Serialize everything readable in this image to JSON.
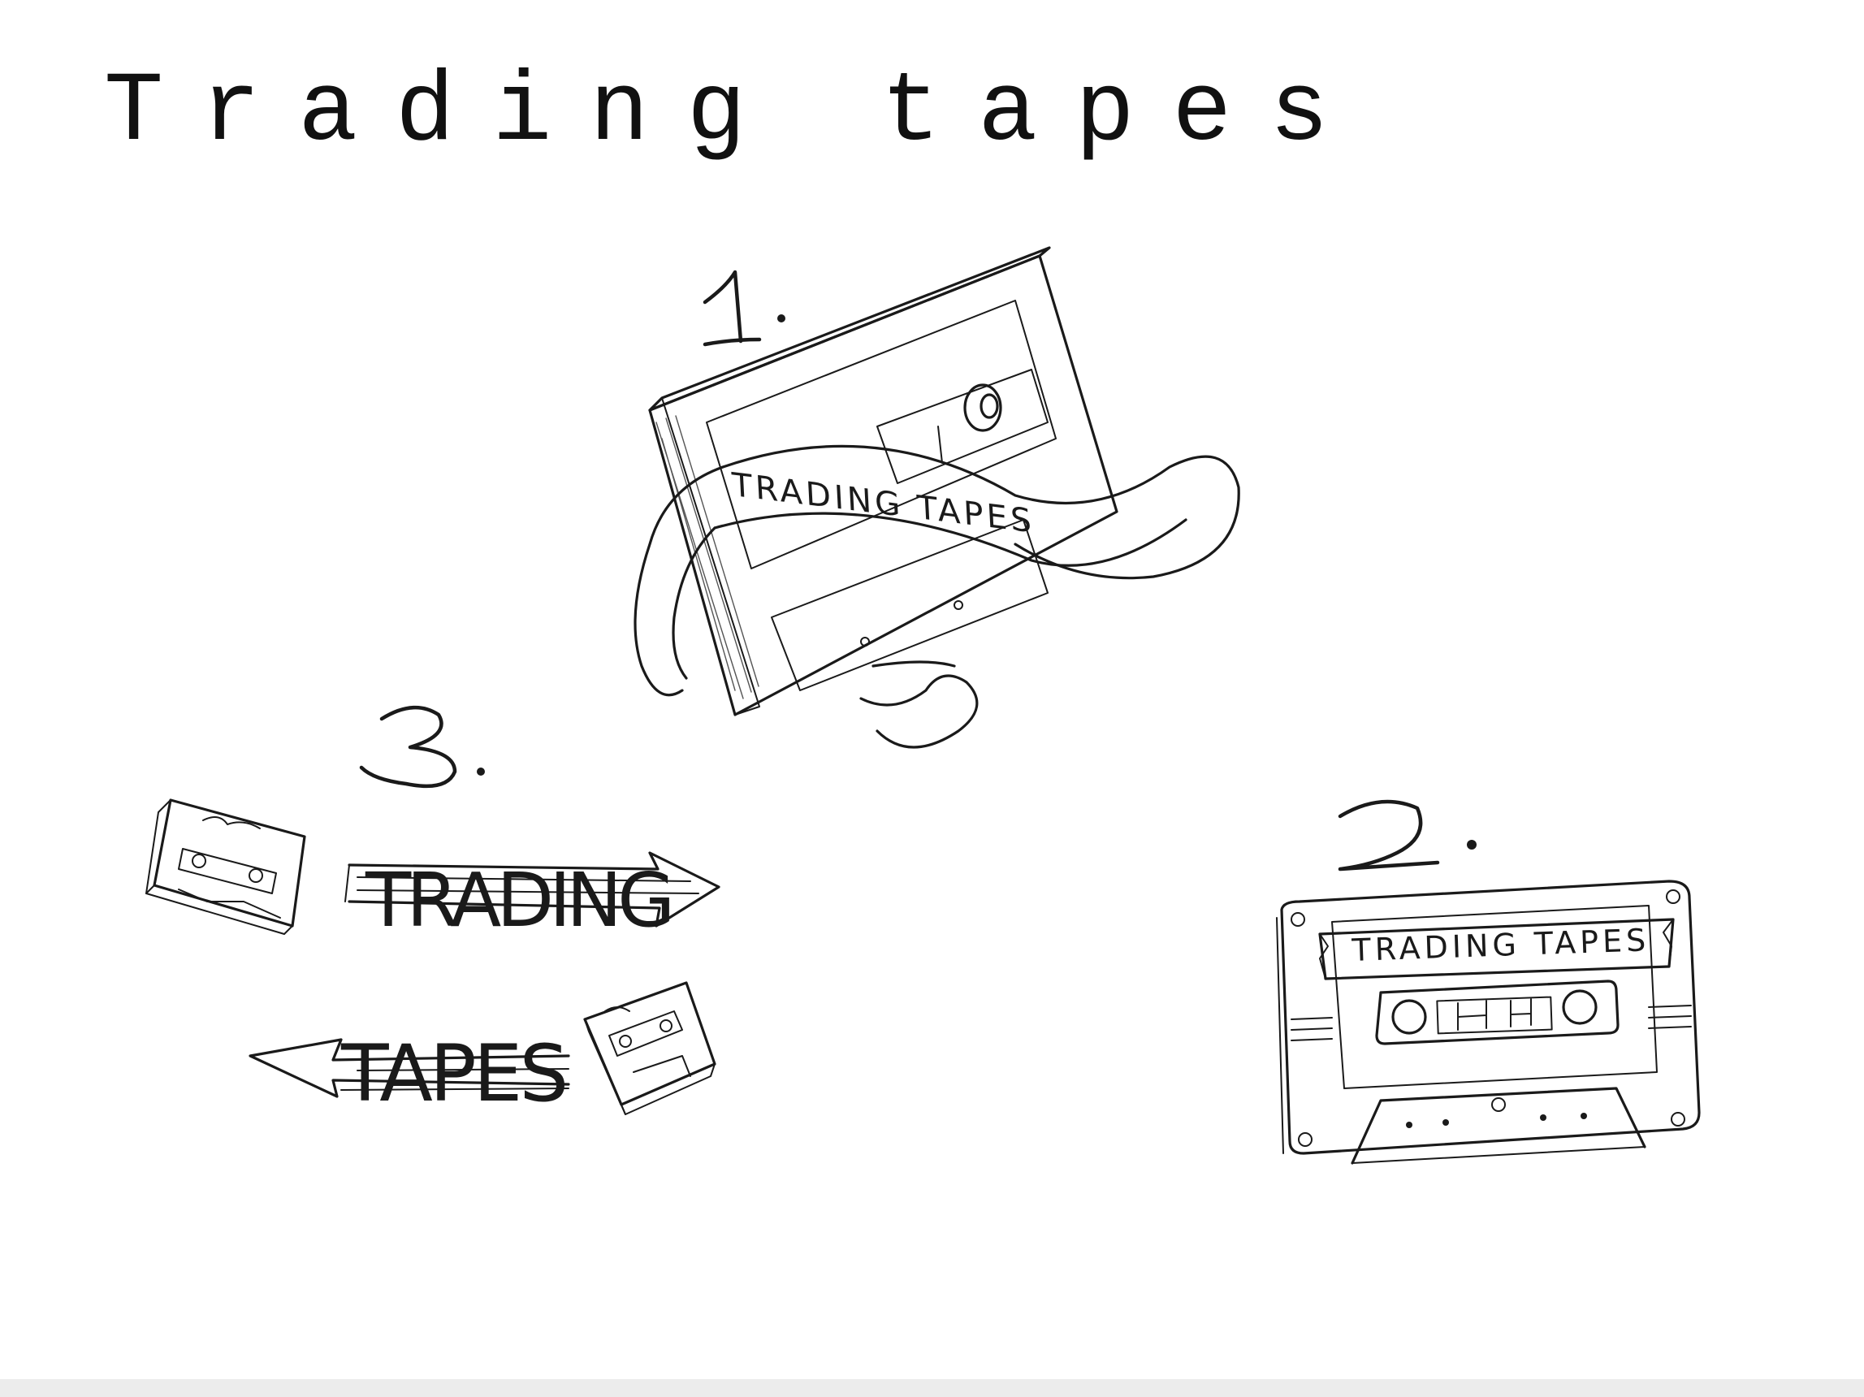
{
  "title": "Trading tapes",
  "sketches": [
    {
      "number": "1.",
      "label": "TRADING TAPES"
    },
    {
      "number": "2.",
      "label": "TRADING TAPES"
    },
    {
      "number": "3.",
      "label_top": "TRADING",
      "label_bottom": "TAPES"
    }
  ],
  "colors": {
    "ink": "#1a1a1a",
    "background": "#ffffff"
  }
}
